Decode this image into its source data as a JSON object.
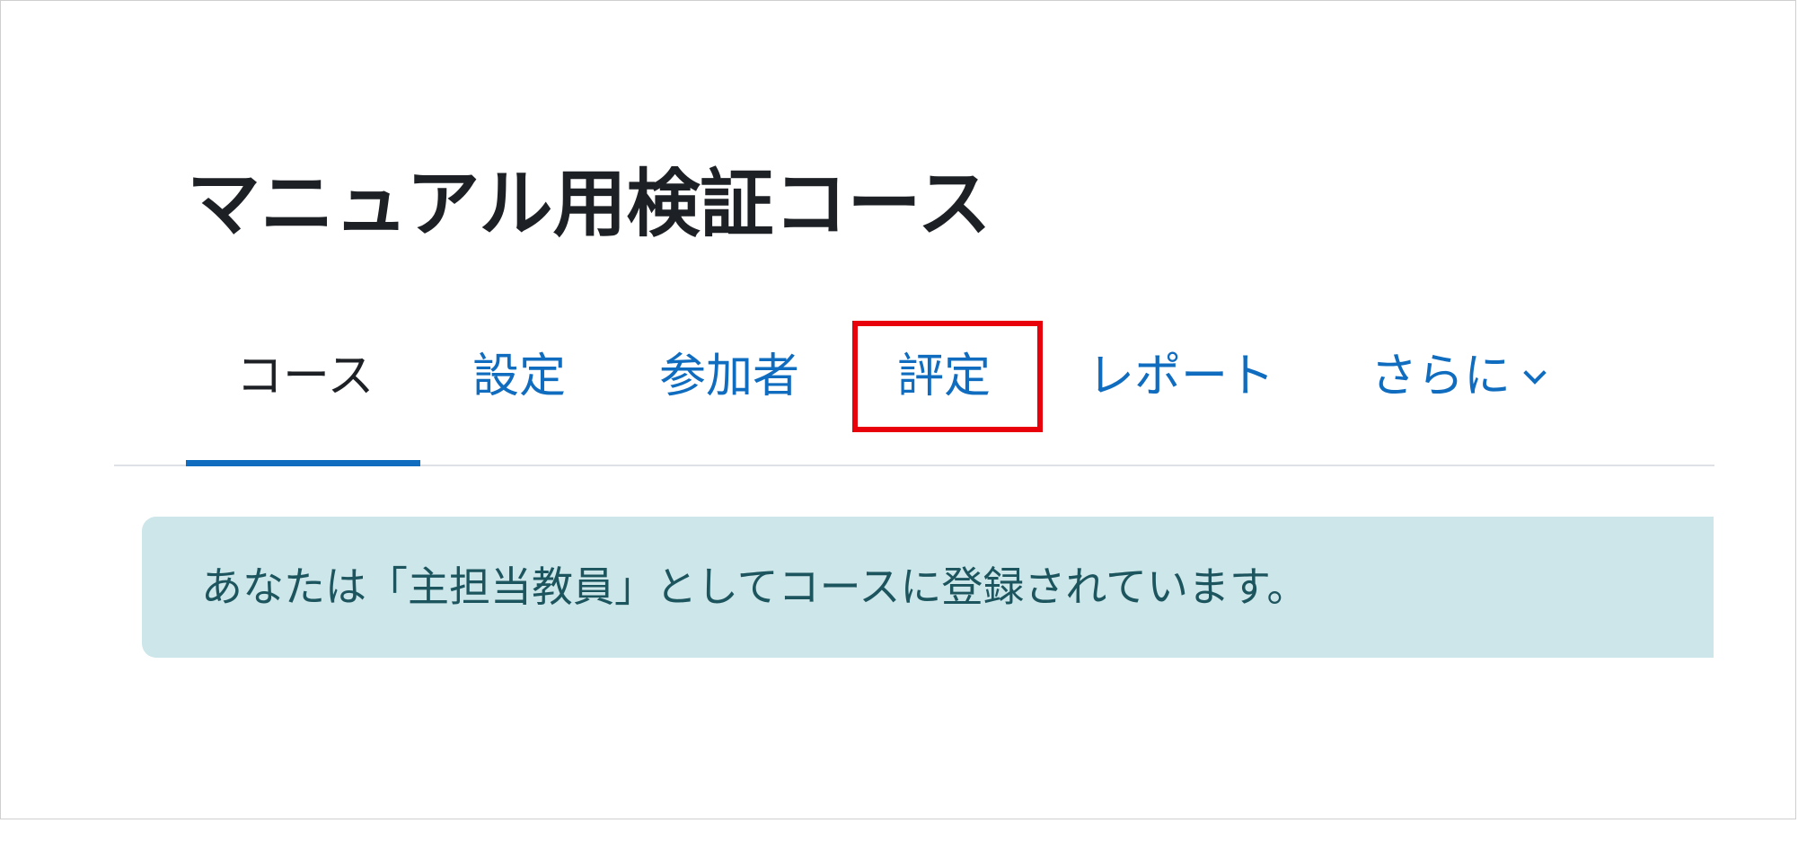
{
  "course": {
    "title": "マニュアル用検証コース"
  },
  "nav": {
    "tabs": [
      {
        "label": "コース",
        "active": true
      },
      {
        "label": "設定",
        "active": false
      },
      {
        "label": "参加者",
        "active": false
      },
      {
        "label": "評定",
        "active": false
      },
      {
        "label": "レポート",
        "active": false
      },
      {
        "label": "さらに",
        "active": false,
        "icon": "chevron-down-icon"
      }
    ]
  },
  "alert": {
    "message": "あなたは「主担当教員」としてコースに登録されています。"
  },
  "colors": {
    "link": "#0f6cbf",
    "highlight": "#e8000b",
    "alert_bg": "#cce6ea",
    "alert_text": "#1d555e"
  }
}
